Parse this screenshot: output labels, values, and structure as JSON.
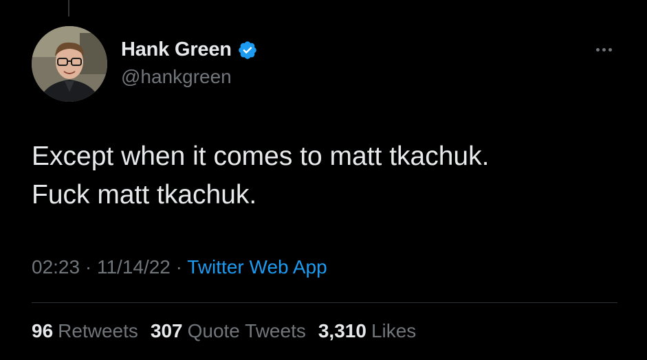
{
  "author": {
    "display_name": "Hank Green",
    "handle": "@hankgreen",
    "verified_icon": "verified-badge-icon",
    "avatar_icon": "profile-photo"
  },
  "tweet": {
    "lines": [
      "Except when it comes to matt tkachuk.",
      "Fuck matt tkachuk."
    ],
    "time": "02:23",
    "separator1": "·",
    "date": "11/14/22",
    "separator2": "·",
    "source": "Twitter Web App"
  },
  "stats": {
    "retweets": {
      "count": "96",
      "label": "Retweets"
    },
    "quote_tweets": {
      "count": "307",
      "label": "Quote Tweets"
    },
    "likes": {
      "count": "3,310",
      "label": "Likes"
    }
  },
  "colors": {
    "background": "#000000",
    "primary_text": "#e7e9ea",
    "secondary_text": "#71767b",
    "accent": "#1d9bf0",
    "divider": "#2f3336"
  },
  "more_icon": "more-horizontal-icon"
}
